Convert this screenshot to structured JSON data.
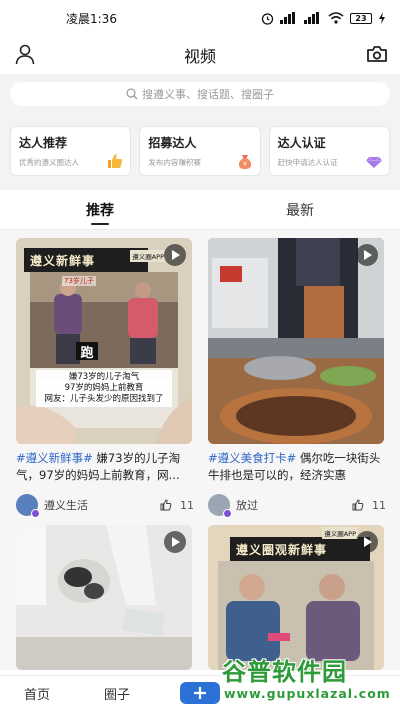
{
  "status_bar": {
    "time": "凌晨1:36",
    "battery": "23"
  },
  "header": {
    "title": "视频",
    "left_icon": "user-icon",
    "right_icon": "camera-icon"
  },
  "search": {
    "placeholder": "搜遵义事、搜话题、搜圈子"
  },
  "cards": [
    {
      "title": "达人推荐",
      "subtitle": "优秀的遵义圈达人",
      "icon": "thumbs-up-icon"
    },
    {
      "title": "招募达人",
      "subtitle": "发布内容赚积赛",
      "icon": "money-bag-icon"
    },
    {
      "title": "达人认证",
      "subtitle": "赶快申请达人认证",
      "icon": "diamond-icon"
    }
  ],
  "tabs": [
    {
      "label": "推荐",
      "active": true
    },
    {
      "label": "最新",
      "active": false
    }
  ],
  "posts": [
    {
      "hashtag": "#遵义新鲜事#",
      "text": " 嫌73岁的儿子淘气，97岁的妈妈上前教育，网...",
      "author": "遵义生活",
      "likes": "11",
      "banner": "遵义新鲜事",
      "brand": "遵义圈APP",
      "sub_caption": "73岁儿子",
      "jin": "跑",
      "caption_lines": [
        "嫌73岁的儿子淘气",
        "97岁的妈妈上前教育",
        "网友：儿子头发少的原因找到了"
      ]
    },
    {
      "hashtag": "#遵义美食打卡#",
      "text": " 偶尔吃一块街头牛排也是可以的，经济实惠",
      "author": "放过",
      "likes": "11"
    },
    {
      "play": true
    },
    {
      "banner": "遵义圈观新鲜事",
      "brand": "遵义圈APP"
    }
  ],
  "bottom_nav": {
    "home": "首页",
    "circle": "圈子",
    "plus_icon": "plus-icon"
  },
  "watermark": {
    "title": "谷普软件园",
    "url": "www.gupuxlazal.com"
  },
  "colors": {
    "accent": "#2b71d6",
    "hashtag": "#2f66c7",
    "watermark": "#2e9b3a"
  }
}
